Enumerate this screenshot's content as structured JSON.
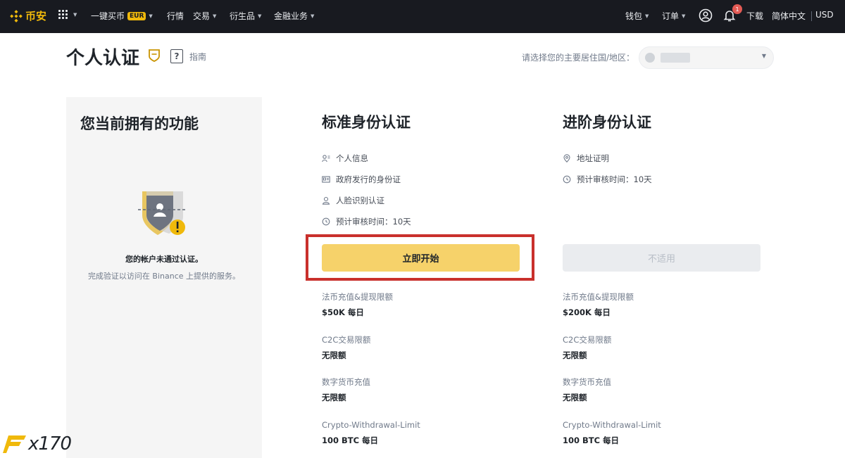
{
  "nav": {
    "logo_text": "币安",
    "buy_crypto": "一键买币",
    "buy_crypto_badge": "EUR",
    "markets": "行情",
    "trade": "交易",
    "derivatives": "衍生品",
    "finance": "金融业务",
    "wallet": "钱包",
    "orders": "订单",
    "notification_count": "1",
    "download": "下载",
    "language": "简体中文",
    "currency": "USD"
  },
  "header": {
    "title": "个人认证",
    "guide": "指南",
    "country_label": "请选择您的主要居住国/地区："
  },
  "features": {
    "title": "您当前拥有的功能",
    "status_text": "您的帐户未通过认证。",
    "status_sub": "完成验证以访问在 Binance 上提供的服务。"
  },
  "standard": {
    "title": "标准身份认证",
    "requirements": [
      {
        "icon": "person-info-icon",
        "text": "个人信息"
      },
      {
        "icon": "id-card-icon",
        "text": "政府发行的身份证"
      },
      {
        "icon": "face-icon",
        "text": "人脸识别认证"
      },
      {
        "icon": "clock-icon",
        "text": "预计审核时间：10天"
      }
    ],
    "button_label": "立即开始",
    "limits": [
      {
        "label": "法币充值&提现限额",
        "value": "$50K 每日"
      },
      {
        "label": "C2C交易限额",
        "value": "无限额"
      },
      {
        "label": "数字货币充值",
        "value": "无限额"
      },
      {
        "label": "Crypto-Withdrawal-Limit",
        "value": "100 BTC 每日"
      }
    ]
  },
  "advanced": {
    "title": "进阶身份认证",
    "requirements": [
      {
        "icon": "location-icon",
        "text": "地址证明"
      },
      {
        "icon": "clock-icon",
        "text": "预计审核时间：10天"
      }
    ],
    "button_label": "不适用",
    "limits": [
      {
        "label": "法币充值&提现限额",
        "value": "$200K 每日"
      },
      {
        "label": "C2C交易限额",
        "value": "无限额"
      },
      {
        "label": "数字货币充值",
        "value": "无限额"
      },
      {
        "label": "Crypto-Withdrawal-Limit",
        "value": "100 BTC 每日"
      }
    ]
  },
  "watermark": "x170",
  "colors": {
    "brand": "#f0b90b",
    "button": "#f6d26a",
    "highlight": "#c9302c",
    "nav_bg": "#181a20"
  }
}
